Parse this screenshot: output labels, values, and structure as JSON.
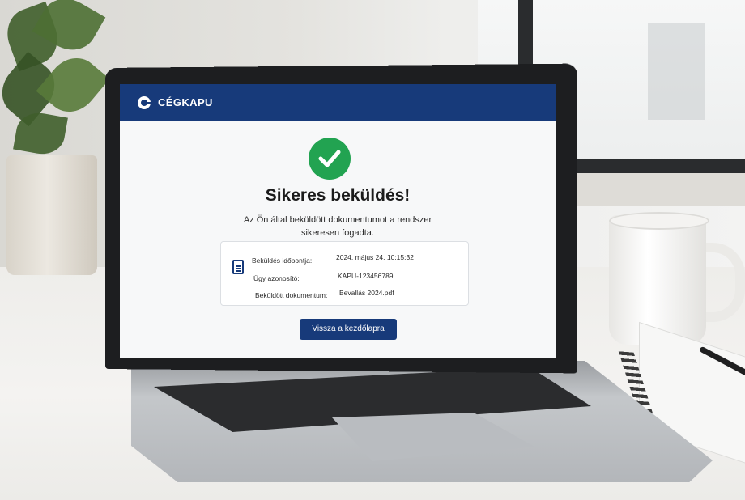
{
  "app": {
    "brand": "CÉGKAPU"
  },
  "status": {
    "title": "Sikeres beküldés!",
    "message": "Az Ön által beküldött dokumentumot a rendszer sikeresen fogadta."
  },
  "details": [
    {
      "label": "Beküldés időpontja:",
      "value": "2024. május 24. 10:15:32"
    },
    {
      "label": "Ügy azonosító:",
      "value": "KAPU-123456789"
    },
    {
      "label": "Beküldött dokumentum:",
      "value": "Bevallás 2024.pdf"
    }
  ],
  "actions": {
    "back_label": "Vissza a kezdőlapra"
  },
  "colors": {
    "header": "#173a7a",
    "success": "#22a351",
    "button": "#173a7a"
  },
  "icons": [
    "check-icon",
    "document-icon",
    "logo-icon"
  ]
}
